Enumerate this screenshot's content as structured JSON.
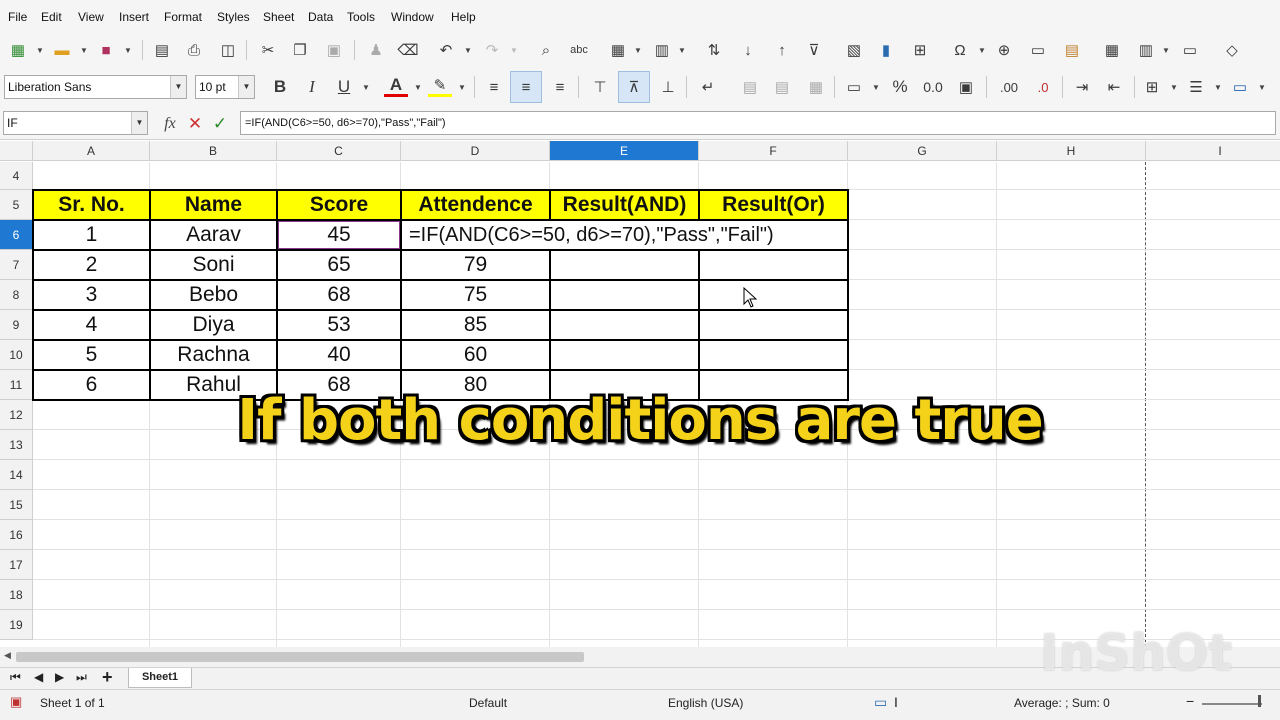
{
  "menu": [
    "File",
    "Edit",
    "View",
    "Insert",
    "Format",
    "Styles",
    "Sheet",
    "Data",
    "Tools",
    "Window",
    "Help"
  ],
  "toolbar": {
    "font_name": "Liberation Sans",
    "font_size": "10 pt",
    "bold": "B",
    "italic": "I",
    "underline": "U",
    "percent": "%",
    "decimal": "0.0",
    "add_decimal": ".00",
    "remove_decimal": ".0",
    "abc": "abc",
    "fx": "fx"
  },
  "formula_bar": {
    "name_box": "IF",
    "formula": "=IF(AND(C6>=50, d6>=70),\"Pass\",\"Fail\")"
  },
  "columns": [
    "A",
    "B",
    "C",
    "D",
    "E",
    "F",
    "G",
    "H",
    "I"
  ],
  "rows": [
    "4",
    "5",
    "6",
    "7",
    "8",
    "9",
    "10",
    "11",
    "12",
    "13",
    "14",
    "15",
    "16",
    "17",
    "18",
    "19"
  ],
  "table": {
    "headers": [
      "Sr. No.",
      "Name",
      "Score",
      "Attendence",
      "Result(AND)",
      "Result(Or)"
    ],
    "rows": [
      [
        "1",
        "Aarav",
        "45",
        ""
      ],
      [
        "2",
        "Soni",
        "65",
        "79"
      ],
      [
        "3",
        "Bebo",
        "68",
        "75"
      ],
      [
        "4",
        "Diya",
        "53",
        "85"
      ],
      [
        "5",
        "Rachna",
        "40",
        "60"
      ],
      [
        "6",
        "Rahul",
        "68",
        "80"
      ]
    ],
    "editing_formula": "=IF(AND(C6>=50, d6>=70),\"Pass\",\"Fail\")"
  },
  "sheet_tab": "Sheet1",
  "status": {
    "sheet": "Sheet 1 of 1",
    "style": "Default",
    "language": "English (USA)",
    "summary": "Average: ; Sum: 0"
  },
  "caption": "If both conditions are true",
  "watermark": "InShOt",
  "colors": {
    "header_fill": "#ffff00",
    "selected_column": "#1f78d1",
    "caption_text": "#f4d21a"
  }
}
